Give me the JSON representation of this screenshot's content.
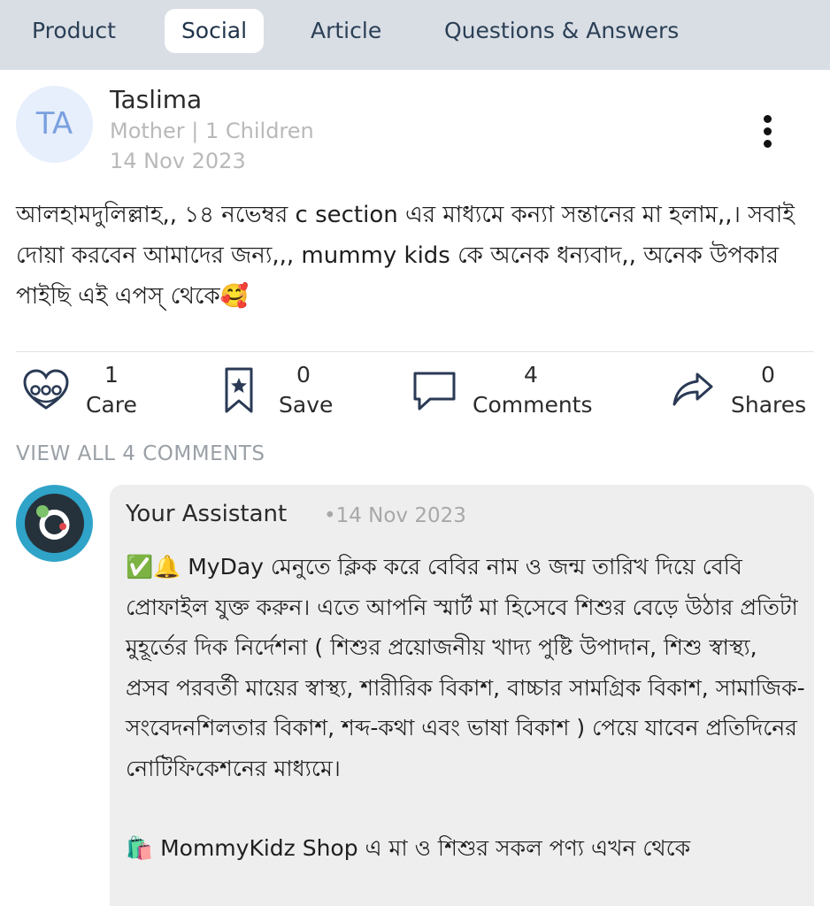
{
  "tabs": {
    "product": "Product",
    "social": "Social",
    "article": "Article",
    "qa": "Questions & Answers"
  },
  "post": {
    "avatar_initials": "TA",
    "author": "Taslima",
    "meta": "Mother | 1 Children",
    "date": "14 Nov 2023",
    "text": "আলহামদুলিল্লাহ,,  ১৪ নভেম্বর  c section এর মাধ্যমে কন্যা সন্তানের মা হলাম,,। সবাই দোয়া করবেন আমাদের জন্য,,, mummy kids কে অনেক ধন্যবাদ,, অনেক উপকার পাইছি এই এপস্ থেকে🥰"
  },
  "actions": {
    "care": {
      "count": "1",
      "label": "Care",
      "icon": "care-heart-icon"
    },
    "save": {
      "count": "0",
      "label": "Save",
      "icon": "bookmark-icon"
    },
    "comments": {
      "count": "4",
      "label": "Comments",
      "icon": "comment-bubble-icon"
    },
    "shares": {
      "count": "0",
      "label": "Shares",
      "icon": "share-arrow-icon"
    }
  },
  "view_all_comments": "VIEW ALL 4 COMMENTS",
  "comment": {
    "author": "Your Assistant",
    "date": "•14 Nov 2023",
    "paragraph1": "✅🔔  MyDay মেনুতে ক্লিক করে বেবির নাম ও জন্ম তারিখ দিয়ে বেবি প্রোফাইল যুক্ত করুন। এতে আপনি স্মার্ট মা হিসেবে শিশুর বেড়ে উঠার প্রতিটা মুহূর্তের দিক নির্দেশনা ( শিশুর প্রয়োজনীয় খাদ্য পুষ্টি উপাদান, শিশু স্বাস্থ্য, প্রসব পরবর্তী মায়ের স্বাস্থ্য, শারীরিক বিকাশ, বাচ্চার সামগ্রিক বিকাশ, সামাজিক-সংবেদনশিলতার বিকাশ, শব্দ-কথা এবং ভাষা বিকাশ ) পেয়ে যাবেন প্রতিদিনের নোটিফিকেশনের মাধ্যমে।",
    "paragraph2": "🛍️ MommyKidz Shop এ মা ও শিশুর সকল পণ্য এখন থেকে"
  },
  "colors": {
    "tabbar_bg": "#d9dee5",
    "tab_text": "#2b3f55",
    "avatar_bg": "#e6effb",
    "avatar_text": "#7aa0e0",
    "muted": "#b9b9b9",
    "comment_bg": "#eeeeee",
    "assistant_ring": "#2fa3c8",
    "icon_stroke": "#2a3a55"
  }
}
